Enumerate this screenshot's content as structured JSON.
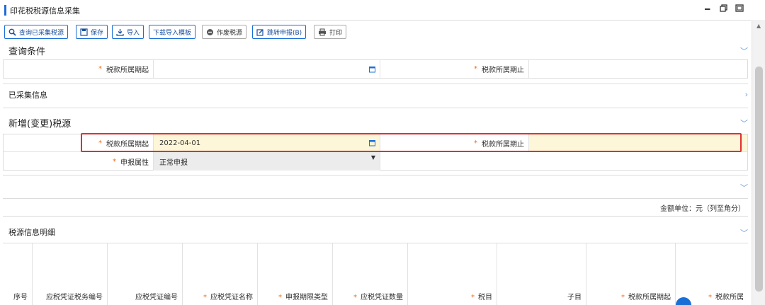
{
  "window": {
    "title": "印花税税源信息采集"
  },
  "toolbar": {
    "buttons": [
      {
        "label": "查询已采集税源"
      },
      {
        "label": "保存"
      },
      {
        "label": "导入"
      },
      {
        "label": "下载导入模板"
      },
      {
        "label": "作废税源"
      },
      {
        "label": "跳转申报(B)"
      },
      {
        "label": "打印"
      }
    ]
  },
  "query": {
    "title": "查询条件",
    "start_label": "税款所属期起",
    "end_label": "税款所属期止"
  },
  "collected": {
    "title": "已采集信息"
  },
  "new_source": {
    "title": "新增(变更)税源",
    "start_label": "税款所属期起",
    "start_value": "2022-04-01",
    "end_label": "税款所属期止",
    "end_value": "",
    "decl_label": "申报属性",
    "decl_value": "正常申报"
  },
  "amount_unit": "金额单位：元（列至角分）",
  "detail": {
    "title": "税源信息明细",
    "columns": [
      {
        "label": "序号",
        "required": false
      },
      {
        "label": "应税凭证税务编号",
        "required": false
      },
      {
        "label": "应税凭证编号",
        "required": false
      },
      {
        "label": "应税凭证名称",
        "required": true
      },
      {
        "label": "申报期限类型",
        "required": true
      },
      {
        "label": "应税凭证数量",
        "required": true
      },
      {
        "label": "税目",
        "required": true
      },
      {
        "label": "子目",
        "required": false
      },
      {
        "label": "税款所属期起",
        "required": true
      },
      {
        "label": "税款所属",
        "required": true
      }
    ]
  },
  "required_mark": "*",
  "colors": {
    "accent": "#1a6fd6",
    "highlight_border": "#e03030",
    "required": "#f26b1d",
    "field_highlight": "#fdf6d8"
  }
}
